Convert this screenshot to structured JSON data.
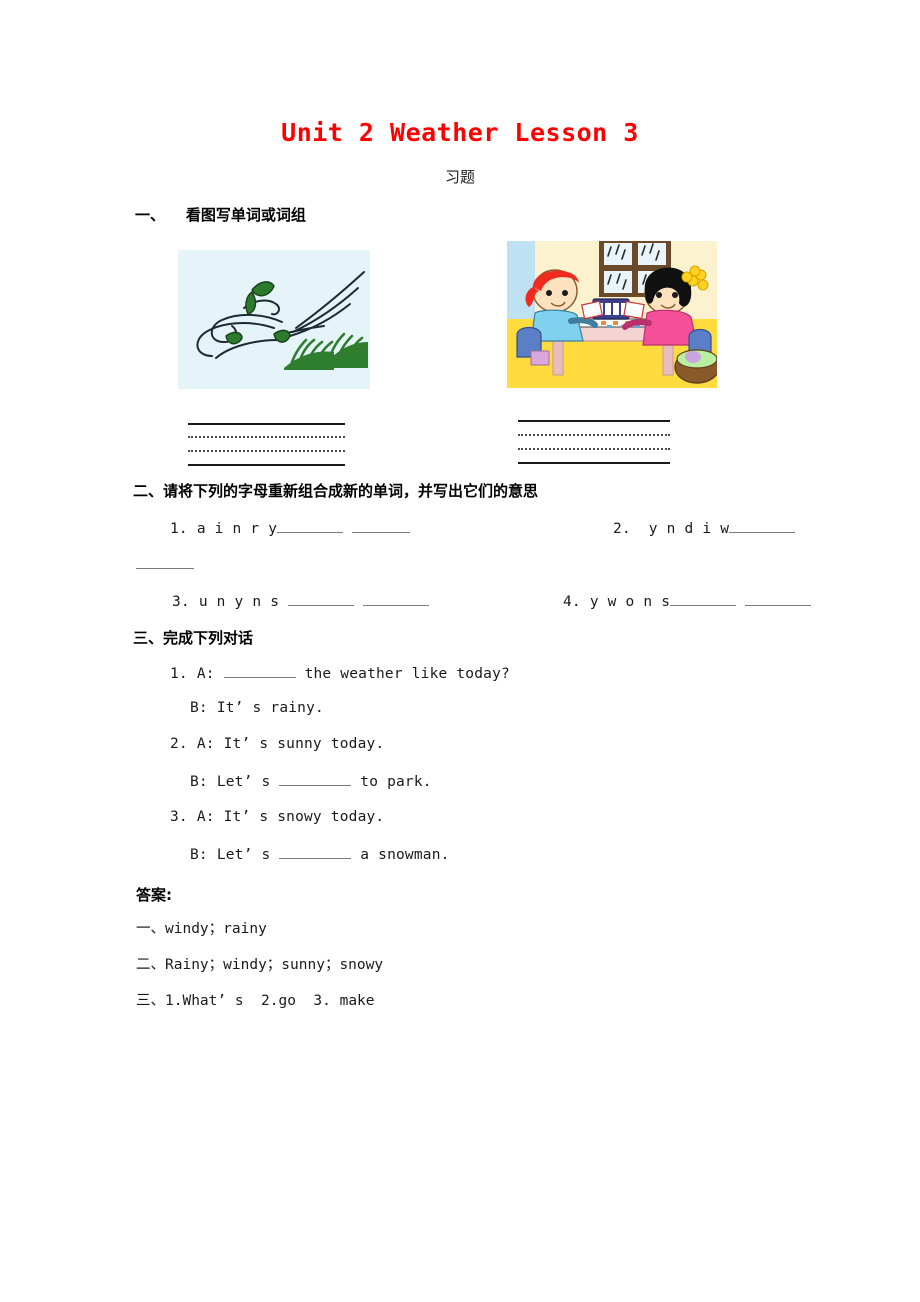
{
  "document": {
    "title": "Unit 2 Weather Lesson 3",
    "title_color": "#ff0000",
    "subtitle": "习题"
  },
  "sections": [
    {
      "heading": "一、    看图写单词或词组",
      "pictures": [
        {
          "name": "windy-scene",
          "alt": "windy day with blowing leaves and grass",
          "answer": "windy"
        },
        {
          "name": "indoor-rainy-scene",
          "alt": "two children playing a board game indoors on a rainy day",
          "answer": "rainy"
        }
      ]
    },
    {
      "heading": "二、请将下列的字母重新组合成新的单词，并写出它们的意思",
      "items": [
        {
          "number": "1.",
          "letters": "a i n r y"
        },
        {
          "number": "2.",
          "letters": "y n d i w"
        },
        {
          "number": "3.",
          "letters": "u n y n s"
        },
        {
          "number": "4.",
          "letters": "y w o n s"
        }
      ]
    },
    {
      "heading": "三、完成下列对话",
      "dialogues": [
        {
          "number": "1.",
          "a_prefix": "A:",
          "a_after": "the weather like today?",
          "b_prefix": "B:",
          "b_text": "It’ s rainy."
        },
        {
          "number": "2.",
          "a_prefix": "A:",
          "a_text": "It’ s sunny today.",
          "b_prefix": "B:",
          "b_before": "Let’ s",
          "b_after": "to park."
        },
        {
          "number": "3.",
          "a_prefix": "A:",
          "a_text": "It’ s snowy today.",
          "b_prefix": "B:",
          "b_before": "Let’ s",
          "b_after": "a snowman."
        }
      ]
    }
  ],
  "answers": {
    "heading": "答案:",
    "lines": [
      "一、windy；rainy",
      "二、Rainy；windy；sunny；snowy",
      "三、1.What’ s  2.go  3. make"
    ]
  }
}
